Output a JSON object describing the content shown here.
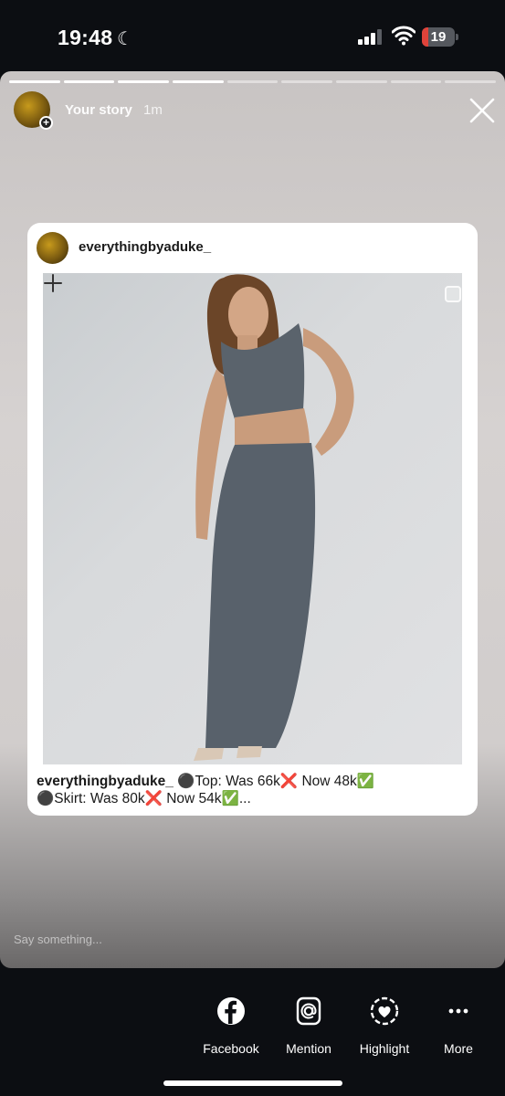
{
  "status_bar": {
    "time": "19:48",
    "battery_level": "19",
    "battery_fraction": 0.19,
    "signal_bars_active": 3,
    "battery_color": "#e0433a",
    "icons": [
      "moon-icon",
      "signal-icon",
      "wifi-icon",
      "battery-icon"
    ]
  },
  "story": {
    "username": "Your story",
    "time_ago": "1m",
    "progress_segments": 9,
    "progress_completed": 4,
    "reply_placeholder": "Say something...",
    "icons": [
      "add-story-icon",
      "close-icon"
    ]
  },
  "post": {
    "username": "everythingbyaduke_",
    "caption_user": "everythingbyaduke_",
    "caption_line1": " ⚫Top: Was 66k❌ Now 48k✅",
    "caption_line2": "⚫Skirt: Was 80k❌ Now 54k✅...",
    "icons": [
      "select-checkbox-icon",
      "plus-icon"
    ]
  },
  "share_bar": {
    "items": [
      {
        "label": "Facebook",
        "icon": "facebook-icon"
      },
      {
        "label": "Mention",
        "icon": "mention-icon"
      },
      {
        "label": "Highlight",
        "icon": "highlight-icon"
      },
      {
        "label": "More",
        "icon": "more-icon"
      }
    ]
  }
}
